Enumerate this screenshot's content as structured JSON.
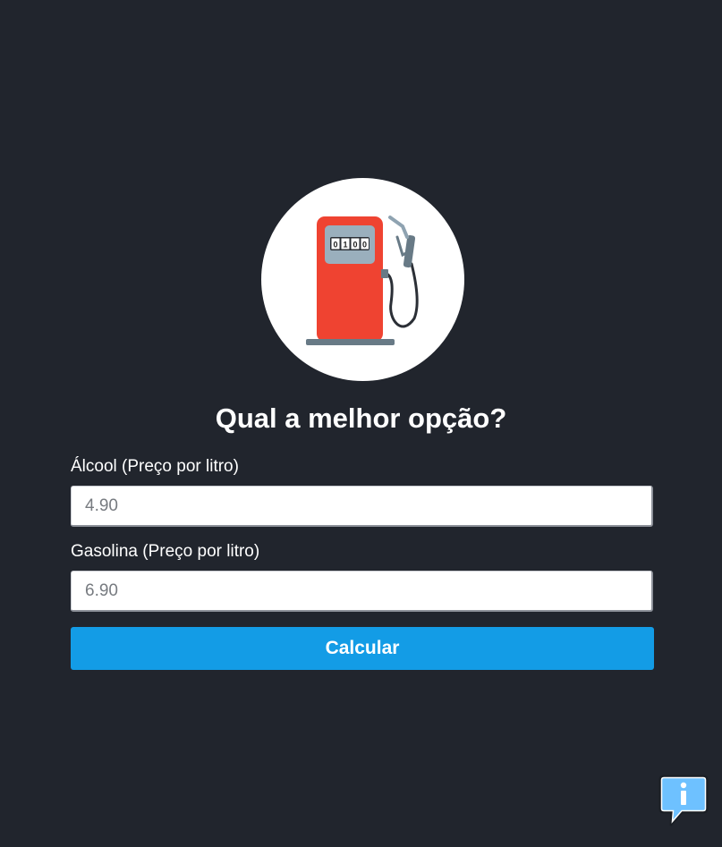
{
  "logo": {
    "icon": "fuel-pump-icon",
    "counter_digits": [
      "0",
      "1",
      "0",
      "0"
    ],
    "colors": {
      "pump_body": "#ef4331",
      "display": "#9aafbd",
      "base": "#687a86",
      "hose": "#2b2f36"
    }
  },
  "title": "Qual a melhor opção?",
  "form": {
    "alcool_label": "Álcool (Preço por litro)",
    "alcool_placeholder": "4.90",
    "gasolina_label": "Gasolina (Preço por litro)",
    "gasolina_placeholder": "6.90",
    "submit_label": "Calcular"
  },
  "info_button": {
    "icon": "info-icon"
  },
  "colors": {
    "background": "#21252d",
    "accent": "#139ce6",
    "text": "#ffffff"
  }
}
